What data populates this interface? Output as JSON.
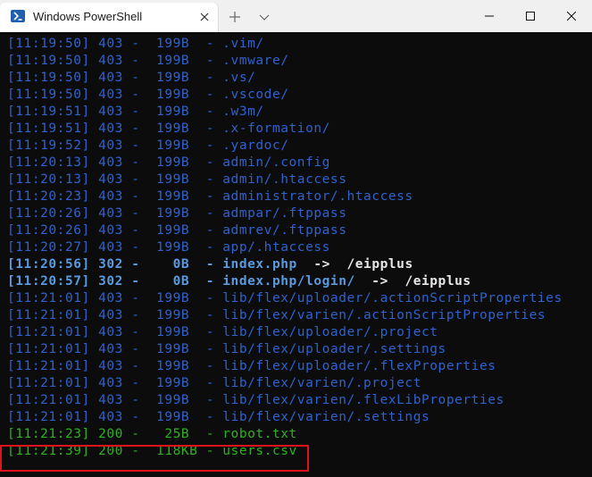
{
  "window": {
    "tab_title": "Windows PowerShell",
    "tab_icon": "powershell-icon",
    "new_tab_icon": "plus-icon",
    "dropdown_icon": "chevron-down-icon",
    "controls": [
      "minimize-icon",
      "maximize-icon",
      "close-icon"
    ]
  },
  "colors": {
    "background": "#0c0c0c",
    "status_403": "#2f62cc",
    "status_302": "#5a9be0",
    "status_200": "#2fb120",
    "highlight_box": "#e0121b"
  },
  "terminal": {
    "lines": [
      {
        "type": "403",
        "text": "[11:19:50] 403 -  199B  - .vim/"
      },
      {
        "type": "403",
        "text": "[11:19:50] 403 -  199B  - .vmware/"
      },
      {
        "type": "403",
        "text": "[11:19:50] 403 -  199B  - .vs/"
      },
      {
        "type": "403",
        "text": "[11:19:50] 403 -  199B  - .vscode/"
      },
      {
        "type": "403",
        "text": "[11:19:51] 403 -  199B  - .w3m/"
      },
      {
        "type": "403",
        "text": "[11:19:51] 403 -  199B  - .x-formation/"
      },
      {
        "type": "403",
        "text": "[11:19:52] 403 -  199B  - .yardoc/"
      },
      {
        "type": "403",
        "text": "[11:20:13] 403 -  199B  - admin/.config"
      },
      {
        "type": "403",
        "text": "[11:20:13] 403 -  199B  - admin/.htaccess"
      },
      {
        "type": "403",
        "text": "[11:20:23] 403 -  199B  - administrator/.htaccess"
      },
      {
        "type": "403",
        "text": "[11:20:26] 403 -  199B  - admpar/.ftppass"
      },
      {
        "type": "403",
        "text": "[11:20:26] 403 -  199B  - admrev/.ftppass"
      },
      {
        "type": "403",
        "text": "[11:20:27] 403 -  199B  - app/.htaccess"
      },
      {
        "type": "302",
        "text": "[11:20:56] 302 -    0B  - index.php",
        "arrow": "  ->  ",
        "target": "/eipplus"
      },
      {
        "type": "302",
        "text": "[11:20:57] 302 -    0B  - index.php/login/",
        "arrow": "  ->  ",
        "target": "/eipplus"
      },
      {
        "type": "403",
        "text": "[11:21:01] 403 -  199B  - lib/flex/uploader/.actionScriptProperties"
      },
      {
        "type": "403",
        "text": "[11:21:01] 403 -  199B  - lib/flex/varien/.actionScriptProperties"
      },
      {
        "type": "403",
        "text": "[11:21:01] 403 -  199B  - lib/flex/uploader/.project"
      },
      {
        "type": "403",
        "text": "[11:21:01] 403 -  199B  - lib/flex/uploader/.settings"
      },
      {
        "type": "403",
        "text": "[11:21:01] 403 -  199B  - lib/flex/uploader/.flexProperties"
      },
      {
        "type": "403",
        "text": "[11:21:01] 403 -  199B  - lib/flex/varien/.project"
      },
      {
        "type": "403",
        "text": "[11:21:01] 403 -  199B  - lib/flex/varien/.flexLibProperties"
      },
      {
        "type": "403",
        "text": "[11:21:01] 403 -  199B  - lib/flex/varien/.settings"
      },
      {
        "type": "200",
        "text": "[11:21:23] 200 -   25B  - robot.txt"
      },
      {
        "type": "200",
        "text": "[11:21:39] 200 -  118KB - users.csv"
      }
    ]
  }
}
